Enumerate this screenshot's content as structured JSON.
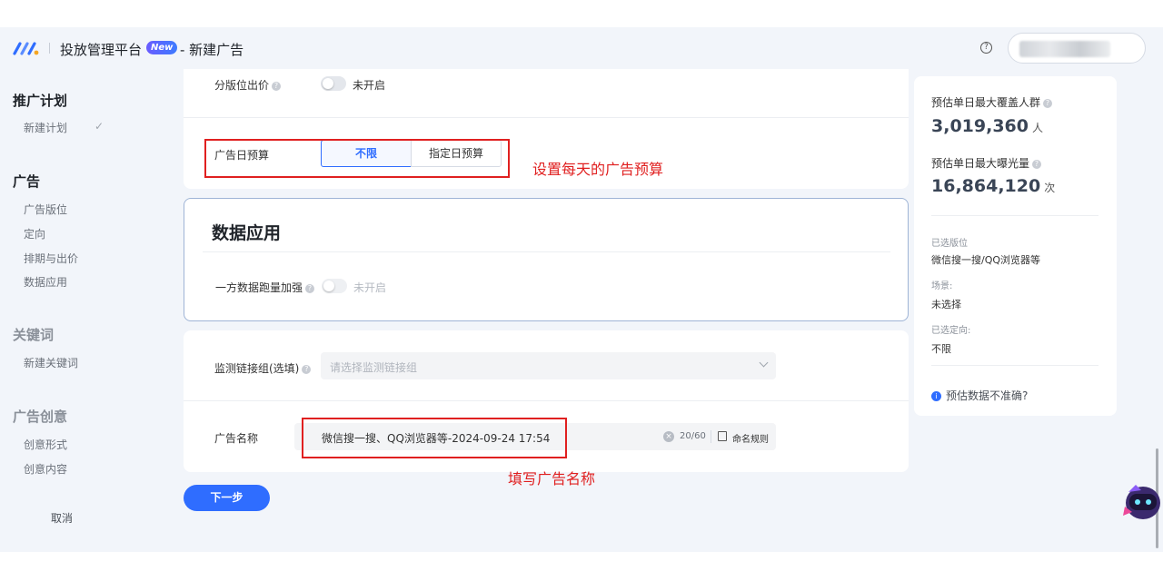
{
  "header": {
    "app_title": "投放管理平台",
    "new_badge": "New",
    "page_title": "- 新建广告"
  },
  "sidebar": {
    "sections": [
      {
        "title": "推广计划",
        "items": [
          "新建计划"
        ]
      },
      {
        "title": "广告",
        "items": [
          "广告版位",
          "定向",
          "排期与出价",
          "数据应用"
        ]
      },
      {
        "title": "关键词",
        "items": [
          "新建关键词"
        ]
      },
      {
        "title": "广告创意",
        "items": [
          "创意形式",
          "创意内容"
        ]
      }
    ],
    "cancel": "取消"
  },
  "bidding_card": {
    "split_bid_label": "分版位出价",
    "split_bid_state": "未开启",
    "daily_budget_label": "广告日预算",
    "budget_options": [
      "不限",
      "指定日预算"
    ],
    "budget_selected": "不限",
    "annotation": "设置每天的广告预算"
  },
  "data_app_card": {
    "title": "数据应用",
    "first_party_label": "一方数据跑量加强",
    "first_party_state": "未开启"
  },
  "name_card": {
    "monitor_label": "监测链接组(选填)",
    "monitor_placeholder": "请选择监测链接组",
    "ad_name_label": "广告名称",
    "ad_name_value": "微信搜一搜、QQ浏览器等-2024-09-24 17:54",
    "counter": "20/60",
    "naming_rule": "命名规则",
    "annotation": "填写广告名称"
  },
  "next_button": "下一步",
  "estimates": {
    "max_reach_label": "预估单日最大覆盖人群",
    "max_reach_value": "3,019,360",
    "max_reach_unit": "人",
    "max_impr_label": "预估单日最大曝光量",
    "max_impr_value": "16,864,120",
    "max_impr_unit": "次",
    "placement_label": "已选版位",
    "placement_value": "微信搜一搜/QQ浏览器等",
    "scene_label": "场景:",
    "scene_value": "未选择",
    "targeting_label": "已选定向:",
    "targeting_value": "不限",
    "inaccurate_link": "预估数据不准确?"
  },
  "colors": {
    "primary": "#2f6dff",
    "annotation_red": "#e02020",
    "background": "#f2f5fa"
  }
}
